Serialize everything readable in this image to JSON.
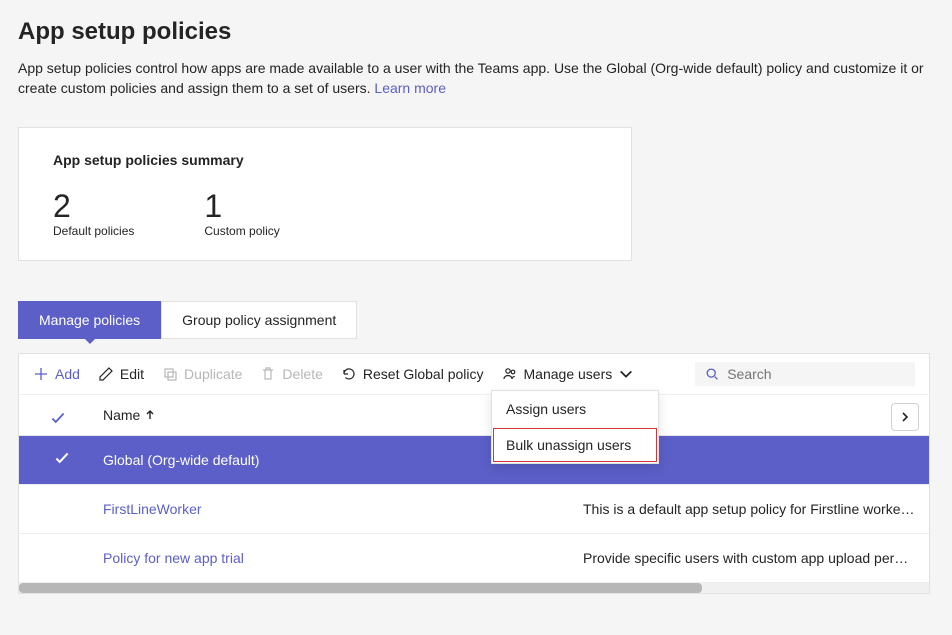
{
  "title": "App setup policies",
  "description_prefix": "App setup policies control how apps are made available to a user with the Teams app. Use the Global (Org-wide default) policy and customize it or create custom policies and assign them to a set of users. ",
  "learn_more": "Learn more",
  "summary": {
    "title": "App setup policies summary",
    "default_count": "2",
    "default_label": "Default policies",
    "custom_count": "1",
    "custom_label": "Custom policy"
  },
  "tabs": {
    "manage": "Manage policies",
    "group": "Group policy assignment"
  },
  "toolbar": {
    "add": "Add",
    "edit": "Edit",
    "duplicate": "Duplicate",
    "delete": "Delete",
    "reset": "Reset Global policy",
    "manage_users": "Manage users",
    "search_placeholder": "Search"
  },
  "dropdown": {
    "assign": "Assign users",
    "bulk_unassign": "Bulk unassign users"
  },
  "columns": {
    "name": "Name"
  },
  "rows": [
    {
      "name": "Global (Org-wide default)",
      "desc": "",
      "selected": true,
      "link": false
    },
    {
      "name": "FirstLineWorker",
      "desc": "This is a default app setup policy for Firstline workers. Th…",
      "selected": false,
      "link": true
    },
    {
      "name": "Policy for new app trial",
      "desc": "Provide specific users with custom app upload permissio…",
      "selected": false,
      "link": true
    }
  ]
}
